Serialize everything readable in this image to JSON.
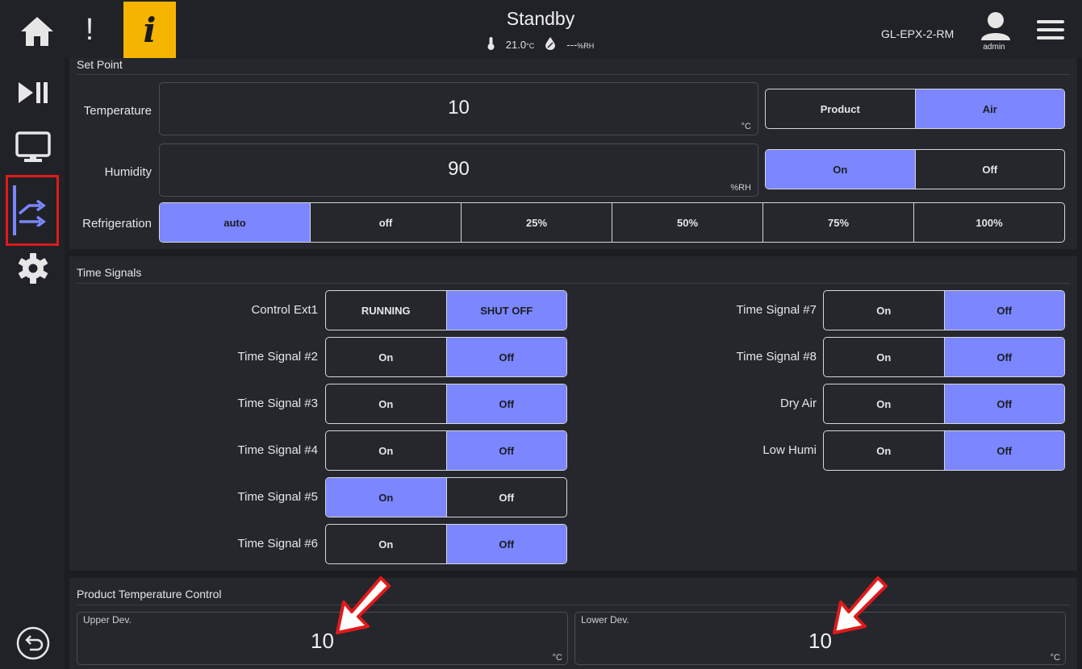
{
  "header": {
    "alarm_glyph": "!",
    "info_glyph": "i",
    "status": "Standby",
    "temperature_value": "21.0",
    "temperature_unit": "°C",
    "humidity_value": "---",
    "humidity_unit": "%RH",
    "device_name": "GL-EPX-2-RM",
    "user": "admin"
  },
  "sidebar": {
    "items": [
      {
        "name": "home",
        "icon": "home-icon"
      },
      {
        "name": "play-pause",
        "icon": "play-pause-icon"
      },
      {
        "name": "monitor",
        "icon": "monitor-icon"
      },
      {
        "name": "profile",
        "icon": "profile-arrows-icon",
        "active": true
      },
      {
        "name": "settings",
        "icon": "gear-icon"
      },
      {
        "name": "back",
        "icon": "back-icon"
      }
    ]
  },
  "set_point": {
    "title": "Set Point",
    "temperature": {
      "label": "Temperature",
      "value": "10",
      "unit": "°C",
      "mode_options": [
        "Product",
        "Air"
      ],
      "mode_selected": "Air"
    },
    "humidity": {
      "label": "Humidity",
      "value": "90",
      "unit": "%RH",
      "options": [
        "On",
        "Off"
      ],
      "selected": "On"
    },
    "refrigeration": {
      "label": "Refrigeration",
      "options": [
        "auto",
        "off",
        "25%",
        "50%",
        "75%",
        "100%"
      ],
      "selected": "auto"
    }
  },
  "time_signals": {
    "title": "Time Signals",
    "left": [
      {
        "label": "Control Ext1",
        "options": [
          "RUNNING",
          "SHUT OFF"
        ],
        "selected": 1
      },
      {
        "label": "Time Signal #2",
        "options": [
          "On",
          "Off"
        ],
        "selected": 1
      },
      {
        "label": "Time Signal #3",
        "options": [
          "On",
          "Off"
        ],
        "selected": 1
      },
      {
        "label": "Time Signal #4",
        "options": [
          "On",
          "Off"
        ],
        "selected": 1
      },
      {
        "label": "Time Signal #5",
        "options": [
          "On",
          "Off"
        ],
        "selected": 0
      },
      {
        "label": "Time Signal #6",
        "options": [
          "On",
          "Off"
        ],
        "selected": 1
      }
    ],
    "right": [
      {
        "label": "Time Signal #7",
        "options": [
          "On",
          "Off"
        ],
        "selected": 1
      },
      {
        "label": "Time Signal #8",
        "options": [
          "On",
          "Off"
        ],
        "selected": 1
      },
      {
        "label": "Dry Air",
        "options": [
          "On",
          "Off"
        ],
        "selected": 1
      },
      {
        "label": "Low Humi",
        "options": [
          "On",
          "Off"
        ],
        "selected": 1
      }
    ]
  },
  "product_temp_control": {
    "title": "Product Temperature Control",
    "upper": {
      "label": "Upper Dev.",
      "value": "10",
      "unit": "°C"
    },
    "lower": {
      "label": "Lower Dev.",
      "value": "10",
      "unit": "°C"
    }
  },
  "colors": {
    "accent": "#7b86ff",
    "info_badge": "#f5b400",
    "highlight_box": "#e01a1a",
    "background": "#1b1d21",
    "panel": "#25272d"
  }
}
